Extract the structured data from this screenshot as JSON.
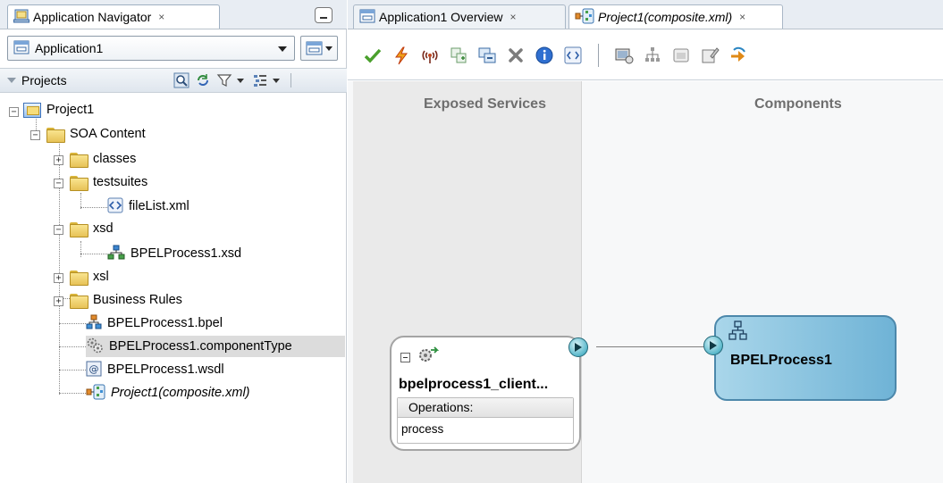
{
  "navigator": {
    "tab_label": "Application Navigator",
    "tab_close": "×",
    "application_select": "Application1",
    "projects_label": "Projects"
  },
  "tree": [
    {
      "label": "Project1",
      "icon": "project-icon"
    },
    {
      "label": "SOA Content",
      "icon": "folder-icon"
    },
    {
      "label": "classes",
      "icon": "folder-icon"
    },
    {
      "label": "testsuites",
      "icon": "folder-icon"
    },
    {
      "label": "fileList.xml",
      "icon": "xml-file-icon"
    },
    {
      "label": "xsd",
      "icon": "folder-icon"
    },
    {
      "label": "BPELProcess1.xsd",
      "icon": "schema-icon"
    },
    {
      "label": "xsl",
      "icon": "folder-icon"
    },
    {
      "label": "Business Rules",
      "icon": "folder-icon"
    },
    {
      "label": "BPELProcess1.bpel",
      "icon": "bpel-icon"
    },
    {
      "label": "BPELProcess1.componentType",
      "icon": "component-type-icon",
      "selected": true
    },
    {
      "label": "BPELProcess1.wsdl",
      "icon": "wsdl-icon"
    },
    {
      "label": "Project1(composite.xml)",
      "icon": "composite-icon"
    }
  ],
  "editor": {
    "tab1_label": "Application1 Overview",
    "tab2_label": "Project1(composite.xml)",
    "tab_close": "×"
  },
  "canvas": {
    "lane_services": "Exposed Services",
    "lane_components": "Components",
    "service_name": "bpelprocess1_client...",
    "operations_header": "Operations:",
    "operation": "process",
    "component_name": "BPELProcess1"
  },
  "colors": {
    "component_fill": "#8cc5e0",
    "port": "#5ab8cb",
    "selection": "#dcdcdc"
  }
}
